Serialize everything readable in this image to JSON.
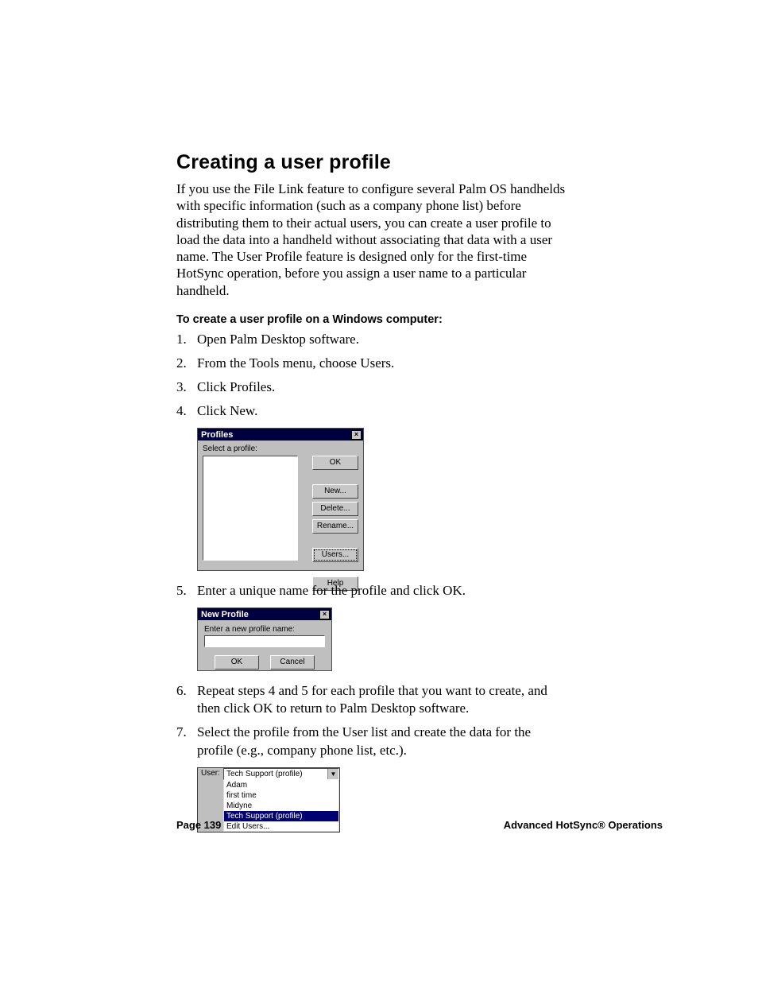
{
  "heading": "Creating a user profile",
  "intro": "If you use the File Link feature to configure several Palm OS handhelds with specific information (such as a company phone list) before distributing them to their actual users, you can create a user profile to load the data into a handheld without associating that data with a user name. The User Profile feature is designed only for the first-time HotSync operation, before you assign a user name to a particular handheld.",
  "subhead": "To create a user profile on a Windows computer:",
  "steps": {
    "s1": "Open Palm Desktop software.",
    "s2": "From the Tools menu, choose Users.",
    "s3": "Click Profiles.",
    "s4": "Click New.",
    "s5": "Enter a unique name for the profile and click OK.",
    "s6": "Repeat steps 4 and 5 for each profile that you want to create, and then click OK to return to Palm Desktop software.",
    "s7": "Select the profile from the User list and create the data for the profile (e.g., company phone list, etc.)."
  },
  "dlg1": {
    "title": "Profiles",
    "select_label": "Select a profile:",
    "buttons": {
      "ok": "OK",
      "new": "New...",
      "delete": "Delete...",
      "rename": "Rename...",
      "users": "Users...",
      "help": "Help"
    }
  },
  "dlg2": {
    "title": "New Profile",
    "prompt": "Enter a new profile name:",
    "ok": "OK",
    "cancel": "Cancel"
  },
  "fig3": {
    "user_label": "User:",
    "selected": "Tech Support (profile)",
    "options": {
      "o1": "Adam",
      "o2": "first time",
      "o3": "Midyne",
      "o4": "Tech Support (profile)",
      "o5": "Edit Users..."
    }
  },
  "footer": {
    "left": "Page 139",
    "right": "Advanced HotSync® Operations"
  }
}
